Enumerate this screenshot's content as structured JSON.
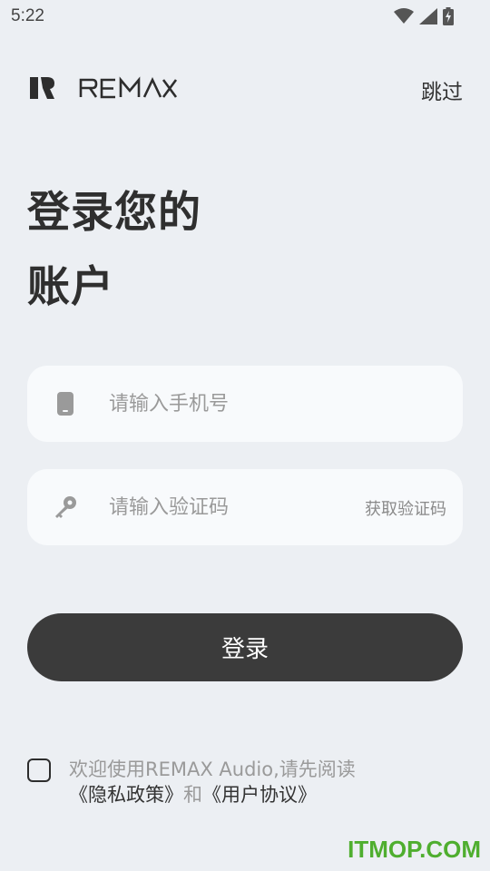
{
  "status_bar": {
    "time": "5:22",
    "icons": [
      "wifi-icon",
      "signal-icon",
      "battery-charging-icon"
    ]
  },
  "header": {
    "brand": "REMAX",
    "skip_label": "跳过"
  },
  "title": {
    "line1": "登录您的",
    "line2": "账户"
  },
  "phone_field": {
    "icon": "phone-icon",
    "placeholder": "请输入手机号",
    "value": ""
  },
  "code_field": {
    "icon": "key-icon",
    "placeholder": "请输入验证码",
    "value": "",
    "get_code_label": "获取验证码"
  },
  "login_button": {
    "label": "登录"
  },
  "agreement": {
    "checked": false,
    "prefix": "欢迎使用REMAX Audio,请先阅读",
    "privacy_link": "《隐私政策》",
    "conjunction": "和",
    "terms_link": "《用户协议》"
  },
  "watermark": {
    "text": "ITMOP.COM"
  },
  "colors": {
    "background": "#eceff3",
    "field_background": "#f8fafc",
    "button": "#3b3b3b",
    "watermark": "#4fae2f"
  }
}
